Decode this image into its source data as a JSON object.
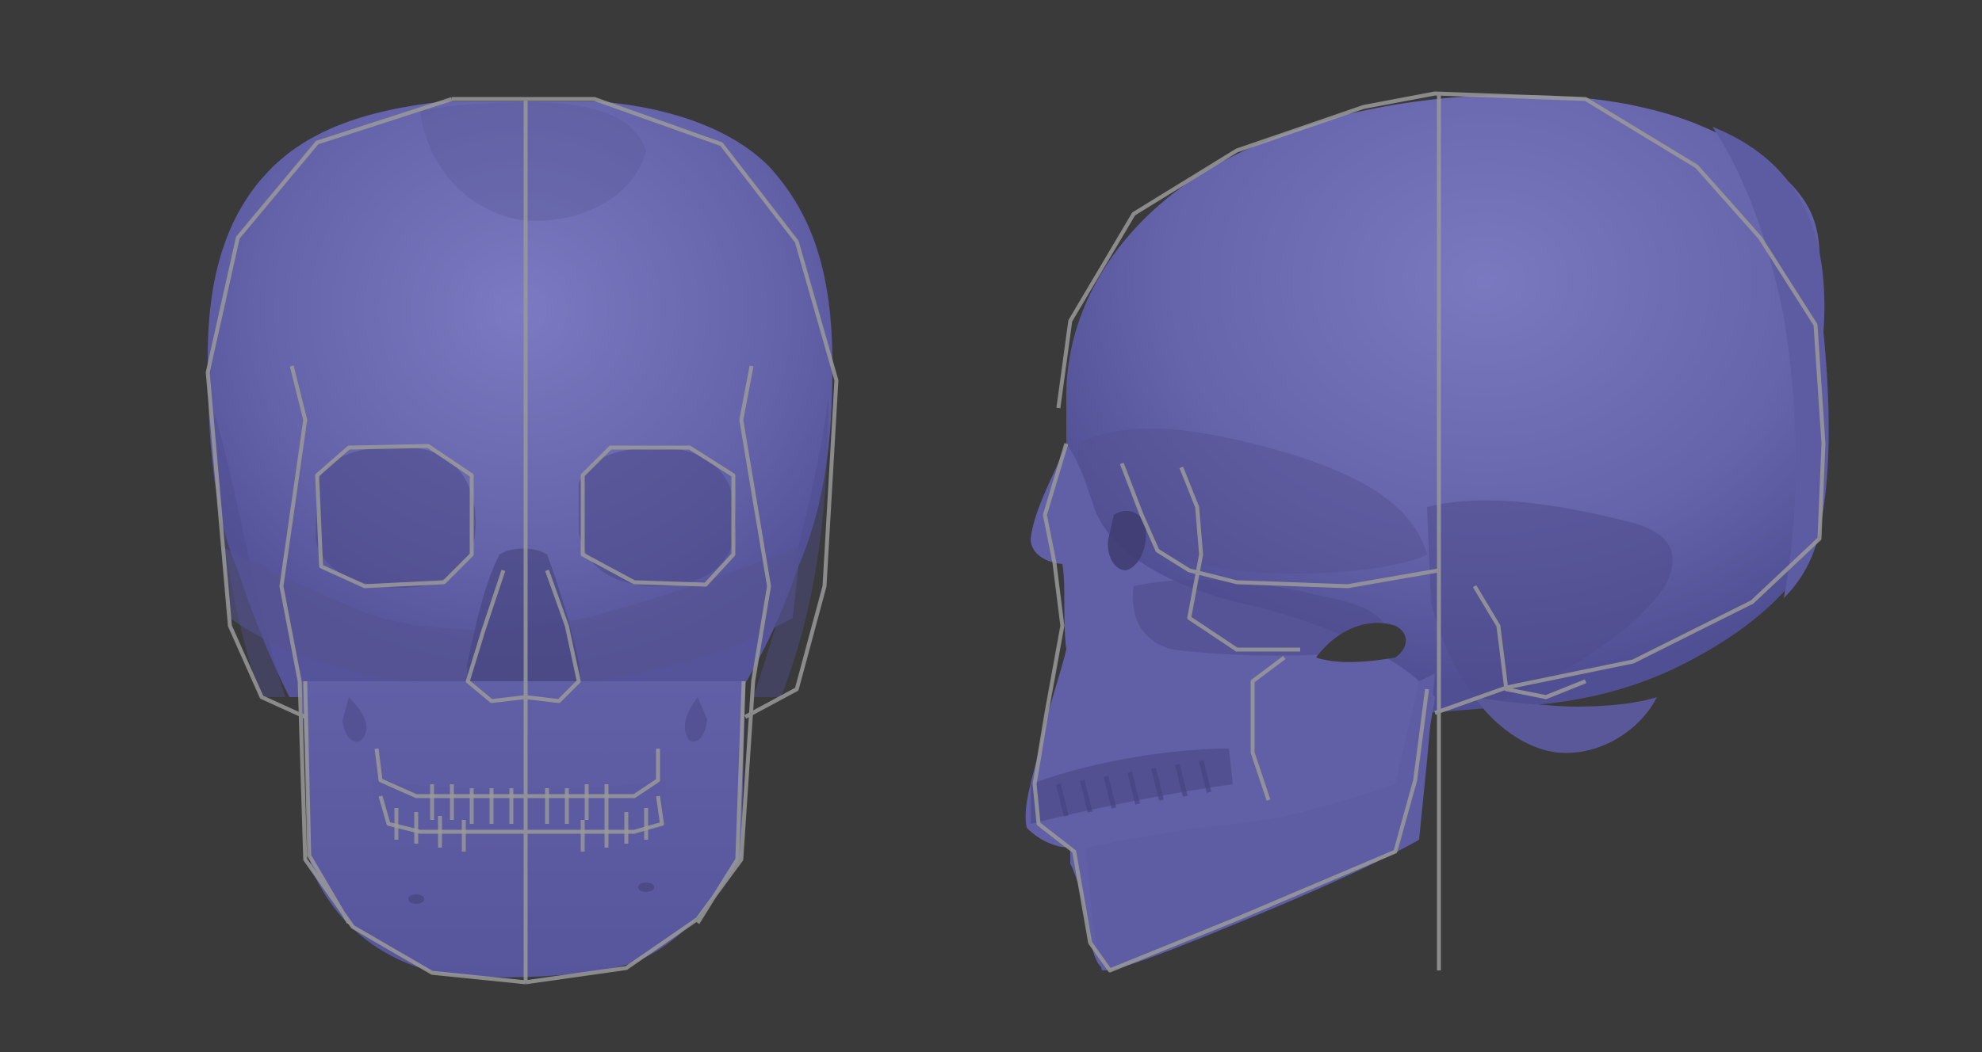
{
  "scene": {
    "background_color": "#3a3a3a",
    "mesh_color": "#6a68b0",
    "mesh_shadow_color": "#4c4a86",
    "mesh_highlight_color": "#7d7cc4",
    "guide_line_color": "#9a9a9a"
  },
  "views": [
    {
      "name": "front-view",
      "subject": "skull"
    },
    {
      "name": "side-view",
      "subject": "skull"
    }
  ]
}
